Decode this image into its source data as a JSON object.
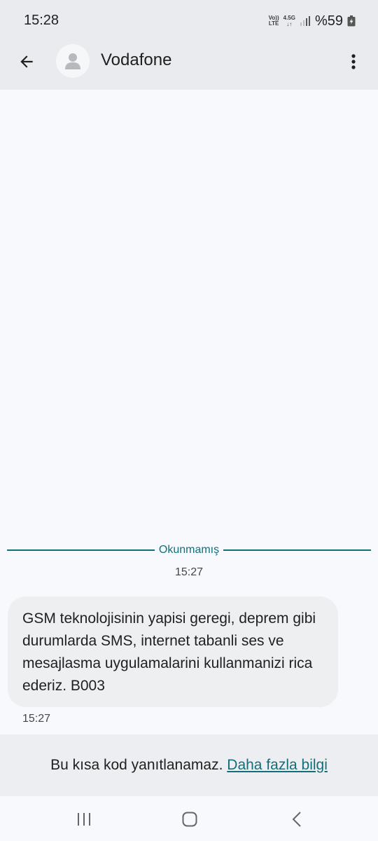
{
  "status_bar": {
    "time": "15:28",
    "volte_top": "Vo))",
    "volte_bottom": "LTE",
    "network_type": "4.5G",
    "battery": "%59"
  },
  "header": {
    "back_icon": "arrow-left-icon",
    "avatar_icon": "person-icon",
    "contact_name": "Vodafone",
    "more_icon": "more-vert-icon"
  },
  "conversation": {
    "unread_label": "Okunmamış",
    "date_time": "15:27",
    "messages": [
      {
        "text": "GSM teknolojisinin yapisi geregi, deprem gibi durumlarda SMS, internet tabanli ses ve mesajlasma uygulamalarini kullanmanizi rica ederiz. B003",
        "time": "15:27"
      }
    ]
  },
  "reply_notice": {
    "text": "Bu kısa kod yanıtlanamaz.",
    "link": "Daha fazla bilgi"
  },
  "nav_bar": {
    "recents_icon": "recents-icon",
    "home_icon": "home-icon",
    "back_icon": "nav-back-icon"
  },
  "colors": {
    "accent": "#10707a",
    "header_bg": "#e9ebee",
    "bubble_bg": "#eeeff1",
    "page_bg": "#f8f9fc"
  }
}
